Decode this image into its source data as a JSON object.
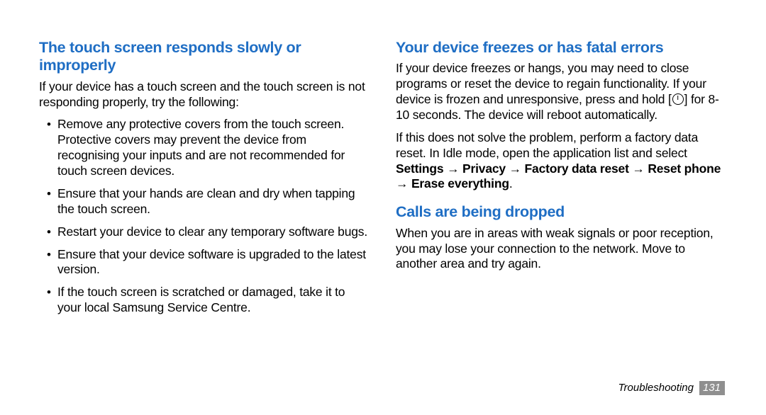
{
  "left": {
    "heading1": "The touch screen responds slowly or improperly",
    "intro1": "If your device has a touch screen and the touch screen is not responding properly, try the following:",
    "bullets1": [
      "Remove any protective covers from the touch screen. Protective covers may prevent the device from recognising your inputs and are not recommended for touch screen devices.",
      "Ensure that your hands are clean and dry when tapping the touch screen.",
      "Restart your device to clear any temporary software bugs.",
      "Ensure that your device software is upgraded to the latest version.",
      "If the touch screen is scratched or damaged, take it to your local Samsung Service Centre."
    ]
  },
  "right": {
    "heading2": "Your device freezes or has fatal errors",
    "para2a_pre": "If your device freezes or hangs, you may need to close programs or reset the device to regain functionality. If your device is frozen and unresponsive, press and hold [",
    "para2a_post": "] for 8-10 seconds. The device will reboot automatically.",
    "para2b_pre": "If this does not solve the problem, perform a factory data reset. In Idle mode, open the application list and select ",
    "bold_path": "Settings → Privacy → Factory data reset → Reset phone → Erase everything",
    "para2b_post": ".",
    "heading3": "Calls are being dropped",
    "para3": "When you are in areas with weak signals or poor reception, you may lose your connection to the network. Move to another area and try again."
  },
  "footer": {
    "section": "Troubleshooting",
    "page": "131"
  }
}
